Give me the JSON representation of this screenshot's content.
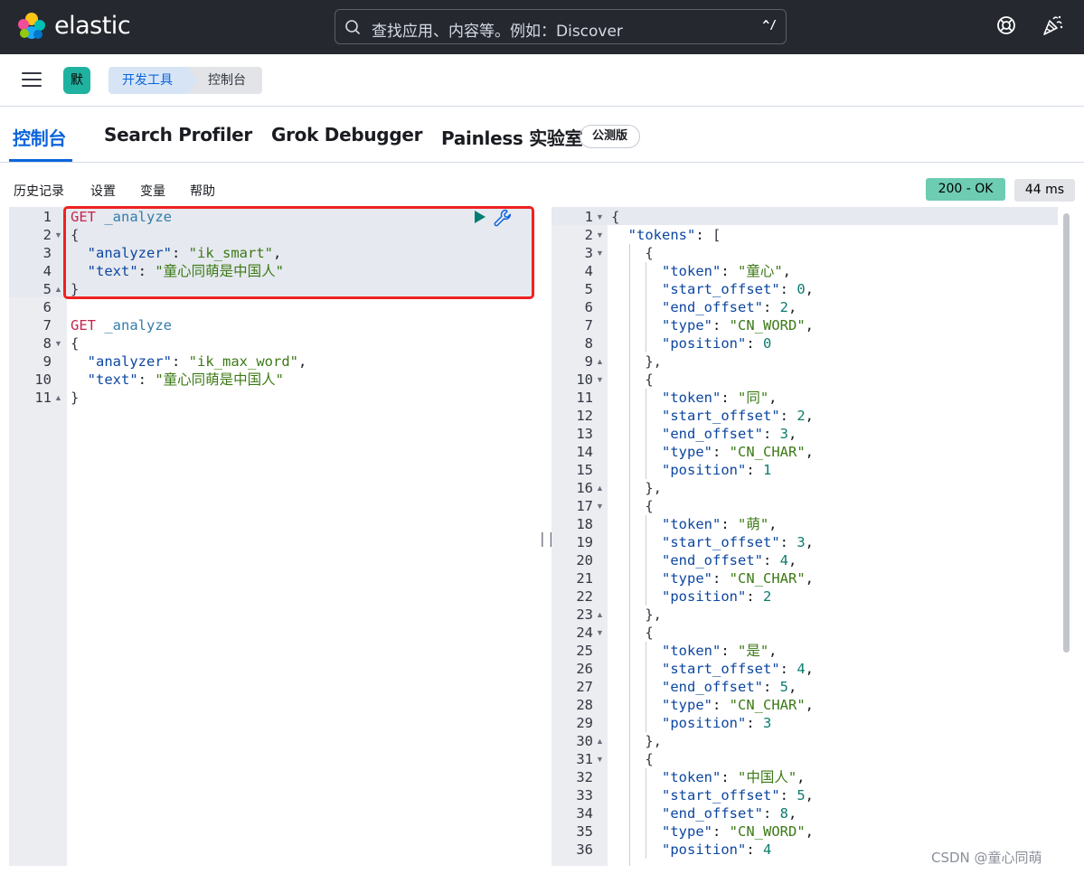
{
  "header": {
    "brand": "elastic",
    "search_placeholder": "查找应用、内容等。例如：Discover",
    "search_shortcut": "^/",
    "icons": [
      "elastic-logo-icon",
      "search-icon",
      "help-icon",
      "news-icon"
    ]
  },
  "breadcrumb": {
    "space_avatar": "默",
    "items": [
      "开发工具",
      "控制台"
    ]
  },
  "tabs": [
    {
      "label": "控制台",
      "active": true
    },
    {
      "label": "Search Profiler",
      "active": false
    },
    {
      "label": "Grok Debugger",
      "active": false
    },
    {
      "label": "Painless 实验室",
      "active": false
    }
  ],
  "beta_badge": "公测版",
  "toolbar": {
    "items": [
      "历史记录",
      "设置",
      "变量",
      "帮助"
    ],
    "status": "200 - OK",
    "duration": "44 ms"
  },
  "request_editor": {
    "lines": [
      "GET _analyze",
      "{",
      "  \"analyzer\": \"ik_smart\",",
      "  \"text\": \"童心同萌是中国人\"",
      "}",
      "",
      "GET _analyze",
      "{",
      "  \"analyzer\": \"ik_max_word\",",
      "  \"text\": \"童心同萌是中国人\"",
      "}"
    ]
  },
  "response_editor": {
    "lines": [
      "{",
      "  \"tokens\": [",
      "    {",
      "      \"token\": \"童心\",",
      "      \"start_offset\": 0,",
      "      \"end_offset\": 2,",
      "      \"type\": \"CN_WORD\",",
      "      \"position\": 0",
      "    },",
      "    {",
      "      \"token\": \"同\",",
      "      \"start_offset\": 2,",
      "      \"end_offset\": 3,",
      "      \"type\": \"CN_CHAR\",",
      "      \"position\": 1",
      "    },",
      "    {",
      "      \"token\": \"萌\",",
      "      \"start_offset\": 3,",
      "      \"end_offset\": 4,",
      "      \"type\": \"CN_CHAR\",",
      "      \"position\": 2",
      "    },",
      "    {",
      "      \"token\": \"是\",",
      "      \"start_offset\": 4,",
      "      \"end_offset\": 5,",
      "      \"type\": \"CN_CHAR\",",
      "      \"position\": 3",
      "    },",
      "    {",
      "      \"token\": \"中国人\",",
      "      \"start_offset\": 5,",
      "      \"end_offset\": 8,",
      "      \"type\": \"CN_WORD\",",
      "      \"position\": 4"
    ]
  },
  "watermark": "CSDN @童心同萌",
  "colors": {
    "header_bg": "#25282f",
    "accent": "#0b64dd",
    "status_ok": "#6dccb1",
    "highlight_box": "#f02020"
  }
}
